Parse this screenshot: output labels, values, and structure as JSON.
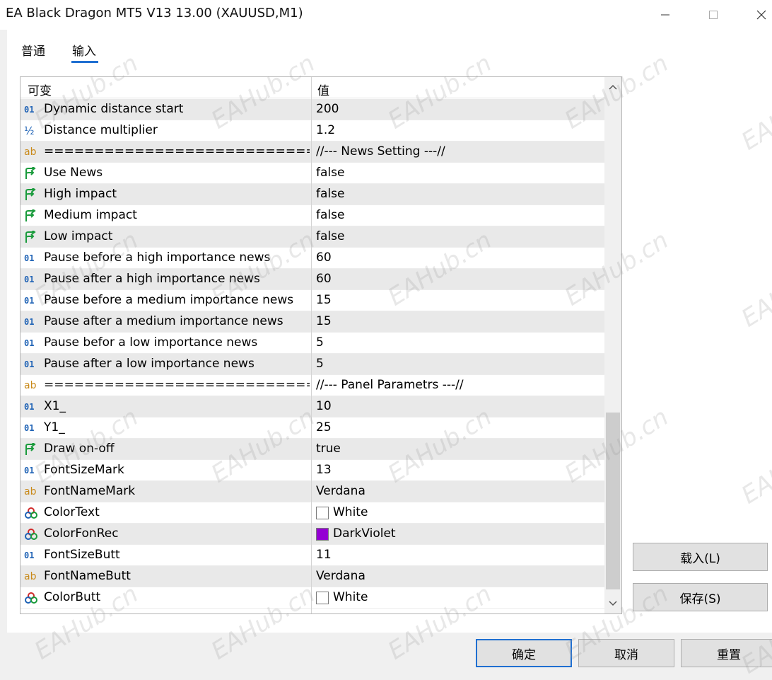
{
  "window": {
    "title": "EA Black Dragon MT5 V13 13.00 (XAUUSD,M1)"
  },
  "tabs": [
    {
      "label": "普通"
    },
    {
      "label": "输入"
    }
  ],
  "grid": {
    "header_name": "可变",
    "header_value": "值",
    "rows": [
      {
        "type": "int",
        "name": "Dynamic distance start",
        "value": "200"
      },
      {
        "type": "double",
        "name": "Distance multiplier",
        "value": "1.2"
      },
      {
        "type": "string",
        "name": "===========================...",
        "value": "//--- News Setting ---//"
      },
      {
        "type": "bool",
        "name": "Use News",
        "value": "false"
      },
      {
        "type": "bool",
        "name": "High impact",
        "value": "false"
      },
      {
        "type": "bool",
        "name": "Medium impact",
        "value": "false"
      },
      {
        "type": "bool",
        "name": "Low impact",
        "value": "false"
      },
      {
        "type": "int",
        "name": "Pause before a high importance news",
        "value": "60"
      },
      {
        "type": "int",
        "name": "Pause after a high importance news",
        "value": "60"
      },
      {
        "type": "int",
        "name": "Pause before a medium importance news",
        "value": "15"
      },
      {
        "type": "int",
        "name": "Pause after a medium importance news",
        "value": "15"
      },
      {
        "type": "int",
        "name": "Pause befor a low importance news",
        "value": "5"
      },
      {
        "type": "int",
        "name": "Pause after a low importance news",
        "value": "5"
      },
      {
        "type": "string",
        "name": "===========================...",
        "value": "//--- Panel Parametrs ---//"
      },
      {
        "type": "int",
        "name": "X1_",
        "value": "10"
      },
      {
        "type": "int",
        "name": "Y1_",
        "value": "25"
      },
      {
        "type": "bool",
        "name": "Draw on-off",
        "value": "true"
      },
      {
        "type": "int",
        "name": "FontSizeMark",
        "value": "13"
      },
      {
        "type": "string",
        "name": "FontNameMark",
        "value": "Verdana"
      },
      {
        "type": "color",
        "name": "ColorText",
        "value": "White",
        "swatch": "#ffffff"
      },
      {
        "type": "color",
        "name": "ColorFonRec",
        "value": "DarkViolet",
        "swatch": "#9400d3"
      },
      {
        "type": "int",
        "name": "FontSizeButt",
        "value": "11"
      },
      {
        "type": "string",
        "name": "FontNameButt",
        "value": "Verdana"
      },
      {
        "type": "color",
        "name": "ColorButt",
        "value": "White",
        "swatch": "#ffffff"
      }
    ]
  },
  "buttons": {
    "load": "载入(L)",
    "save": "保存(S)",
    "ok": "确定",
    "cancel": "取消",
    "reset": "重置"
  },
  "watermark": "EAHub.cn",
  "colors": {
    "accent": "#1f6fd1",
    "bool_icon": "#1a9b3c",
    "int_icon": "#1e62b5",
    "string_icon": "#c98a1a"
  }
}
